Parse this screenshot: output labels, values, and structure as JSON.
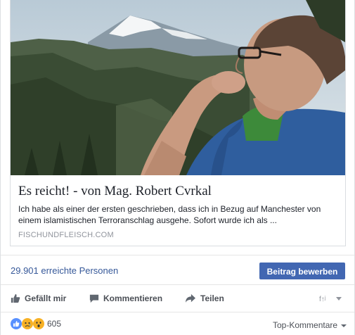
{
  "link_card": {
    "image_icon": "photo-of-man-in-mountains",
    "title": "Es reicht! - von Mag. Robert Cvrkal",
    "description": "Ich habe als einer der ersten geschrieben, dass ich in Bezug auf Manchester von einem islamistischen Terroranschlag ausgehe. Sofort wurde ich als ...",
    "domain": "FISCHUNDFLEISCH.COM"
  },
  "insights": {
    "reach_text": "29.901 erreichte Personen",
    "boost_label": "Beitrag bewerben"
  },
  "actions": {
    "like_label": "Gefällt mir",
    "like_icon": "thumbs-up-icon",
    "comment_label": "Kommentieren",
    "comment_icon": "speech-bubble-icon",
    "share_label": "Teilen",
    "share_icon": "share-arrow-icon",
    "reaction_selector_icon": "reaction-selector-icon"
  },
  "reactions": {
    "icons": [
      "like-reaction-icon",
      "sad-reaction-icon",
      "wow-reaction-icon"
    ],
    "count": "605"
  },
  "comments": {
    "sort_label": "Top-Kommentare"
  },
  "colors": {
    "link": "#365899",
    "button": "#4267b2",
    "text": "#1d2129",
    "muted": "#90949c"
  }
}
